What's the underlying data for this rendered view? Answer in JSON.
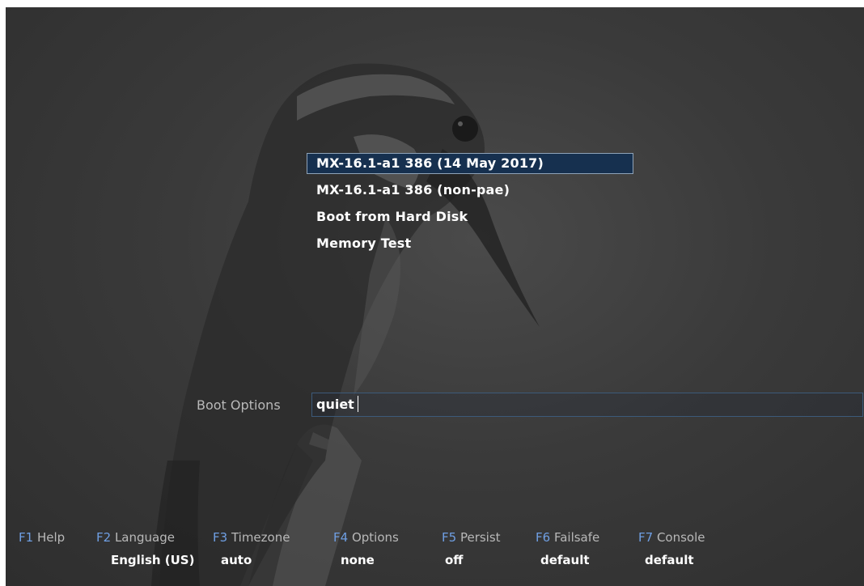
{
  "menu": {
    "items": [
      {
        "label": "MX-16.1-a1 386 (14 May 2017)"
      },
      {
        "label": "MX-16.1-a1 386 (non-pae)"
      },
      {
        "label": "Boot from Hard Disk"
      },
      {
        "label": "Memory Test"
      }
    ],
    "selected_index": 0
  },
  "boot_options": {
    "label": "Boot Options",
    "value": "quiet"
  },
  "function_keys": [
    {
      "key": "F1",
      "name": "Help",
      "value": ""
    },
    {
      "key": "F2",
      "name": "Language",
      "value": "English (US)"
    },
    {
      "key": "F3",
      "name": "Timezone",
      "value": "auto"
    },
    {
      "key": "F4",
      "name": "Options",
      "value": "none"
    },
    {
      "key": "F5",
      "name": "Persist",
      "value": "off"
    },
    {
      "key": "F6",
      "name": "Failsafe",
      "value": "default"
    },
    {
      "key": "F7",
      "name": "Console",
      "value": "default"
    }
  ],
  "colors": {
    "background": "#3a3a3a",
    "selection": "#16304f",
    "fkey_accent": "#6f9fe3",
    "field_border": "#3c5a7a"
  },
  "background_image": "kingfisher-bird-perched-on-branch"
}
